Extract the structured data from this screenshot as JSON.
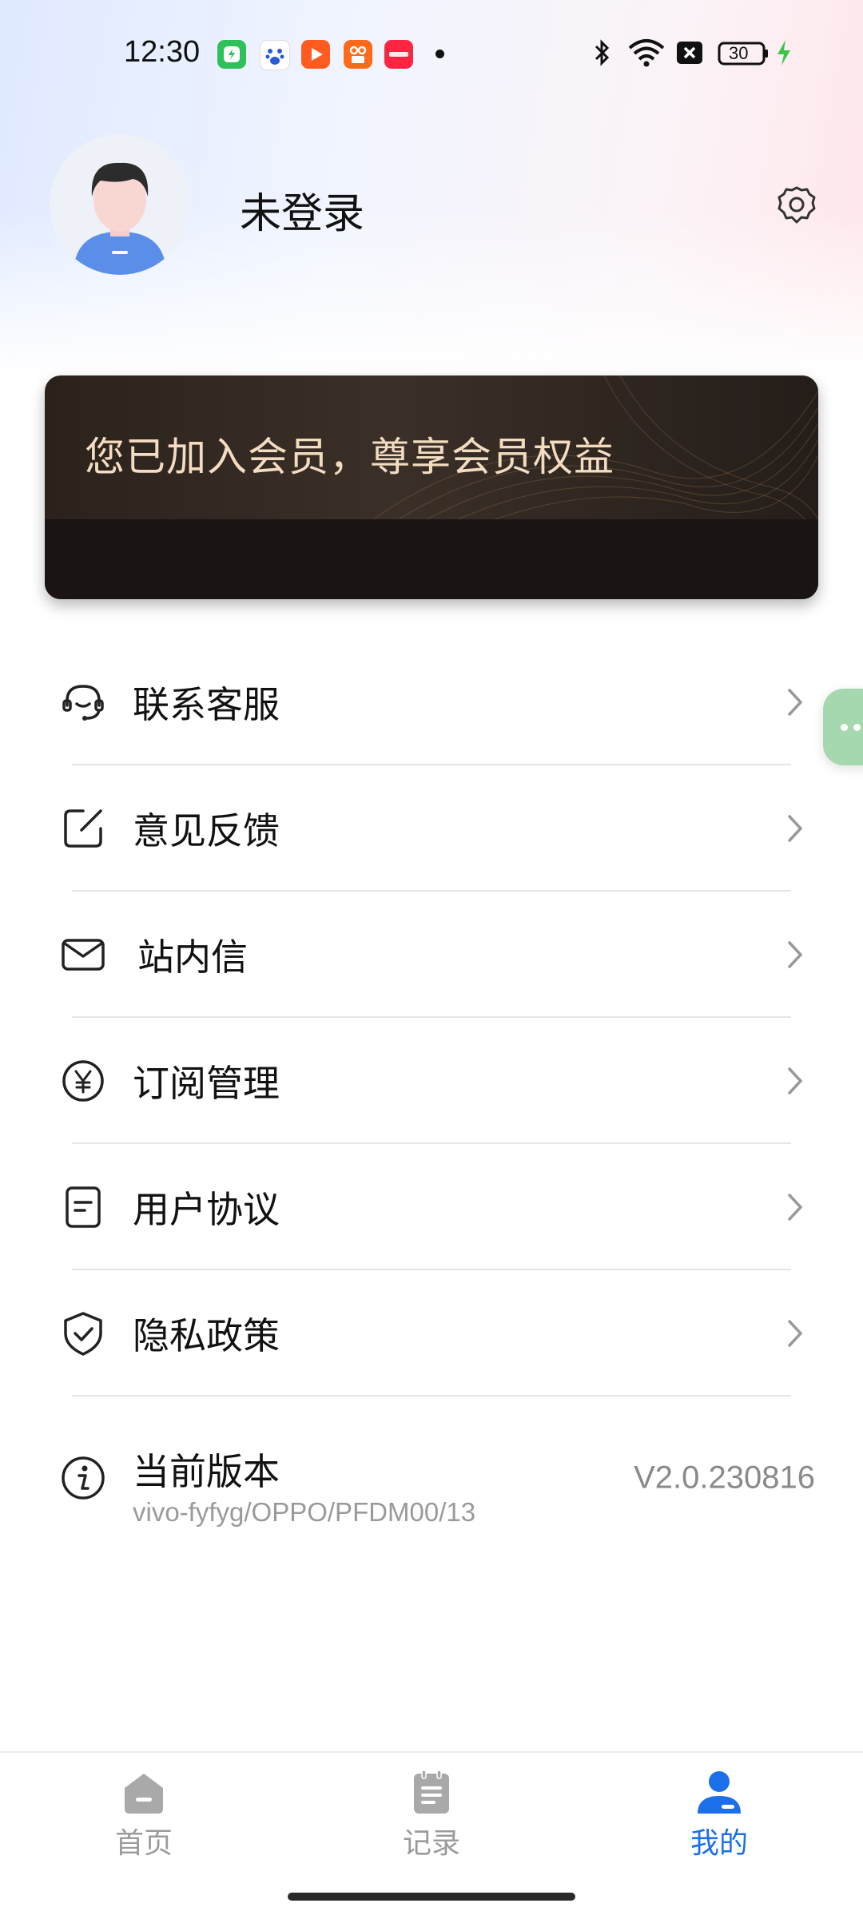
{
  "status_bar": {
    "time": "12:30",
    "battery": "30",
    "icons": [
      "app-green-icon",
      "baidu-icon",
      "video-icon",
      "kuaishou-icon",
      "xiaohongshu-icon",
      "bluetooth-icon",
      "wifi-icon",
      "close-box-icon",
      "battery-icon",
      "charging-icon"
    ]
  },
  "header": {
    "username": "未登录",
    "avatar": "avatar-icon",
    "settings_icon": "gear-icon"
  },
  "member_card": {
    "text": "您已加入会员，尊享会员权益"
  },
  "menu": [
    {
      "label": "联系客服",
      "icon": "headset-icon"
    },
    {
      "label": "意见反馈",
      "icon": "edit-icon"
    },
    {
      "label": "站内信",
      "icon": "mail-icon"
    },
    {
      "label": "订阅管理",
      "icon": "yen-circle-icon"
    },
    {
      "label": "用户协议",
      "icon": "document-icon"
    },
    {
      "label": "隐私政策",
      "icon": "shield-check-icon"
    }
  ],
  "version": {
    "label": "当前版本",
    "sub": "vivo-fyfyg/OPPO/PFDM00/13",
    "value": "V2.0.230816",
    "icon": "info-icon"
  },
  "bottom_nav": [
    {
      "label": "首页",
      "icon": "home-icon",
      "active": false
    },
    {
      "label": "记录",
      "icon": "clipboard-icon",
      "active": false
    },
    {
      "label": "我的",
      "icon": "person-icon",
      "active": true
    }
  ],
  "colors": {
    "accent": "#1b6fe8",
    "card_text": "#f3dcc0",
    "card_bg": "#2b221c",
    "float_button": "#a6d8b0"
  }
}
